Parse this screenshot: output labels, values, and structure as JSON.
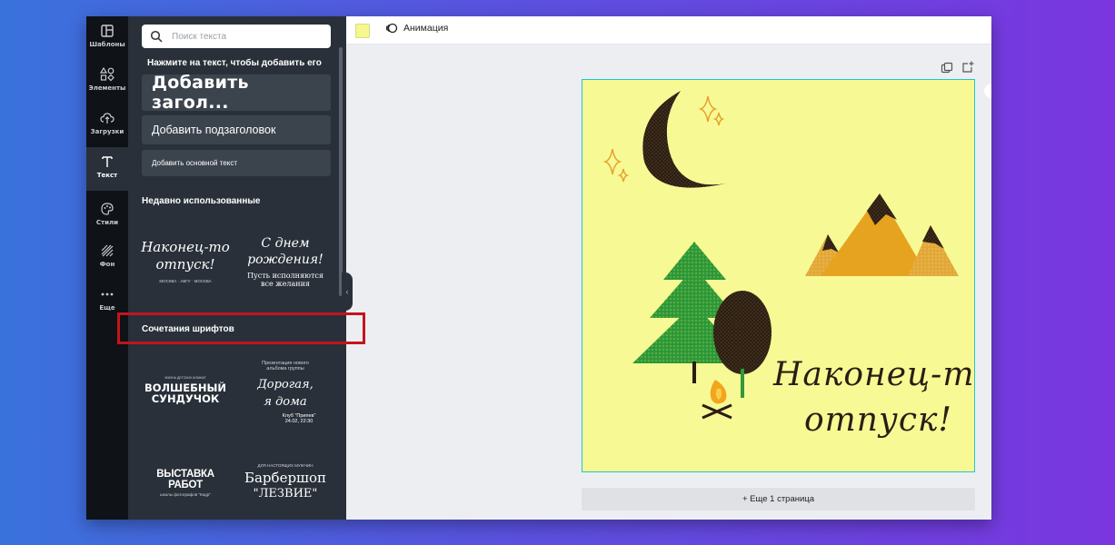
{
  "rail": {
    "items": [
      {
        "label": "Шаблоны",
        "icon": "template-icon"
      },
      {
        "label": "Элементы",
        "icon": "shapes-icon"
      },
      {
        "label": "Загрузки",
        "icon": "upload-cloud-icon"
      },
      {
        "label": "Текст",
        "icon": "text-icon",
        "active": true
      },
      {
        "label": "Стили",
        "icon": "palette-icon"
      },
      {
        "label": "Фон",
        "icon": "background-pattern-icon"
      },
      {
        "label": "Еще",
        "icon": "more-dots-icon"
      }
    ]
  },
  "panel": {
    "search_placeholder": "Поиск текста",
    "hint": "Нажмите на текст, чтобы добавить его",
    "add_heading": "Добавить загол...",
    "add_subheading": "Добавить подзаголовок",
    "add_body": "Добавить основной текст",
    "recent_title": "Недавно использованные",
    "recent": {
      "tile1": {
        "line1": "Наконец-то",
        "line2": "отпуск!",
        "line3": "МОСКВА · АВГУ · МОСКВА"
      },
      "tile2": {
        "line1": "С днем",
        "line2": "рождения!",
        "line3": "Пусть исполняются",
        "line4": "все желания"
      }
    },
    "combos_title": "Сочетания шрифтов",
    "combos": {
      "tile1": {
        "small": "ЖИЗНЬ ДЕТСКИХ КОМНАТ",
        "line1": "ВОЛШЕБНЫЙ",
        "line2": "СУНДУЧОК"
      },
      "tile2": {
        "small1": "Презентация нового",
        "small2": "альбома группы",
        "line1": "Дорогая,",
        "line2": "я дома",
        "club": "Клуб \"Припев\"",
        "date": "24.02, 22:30"
      },
      "tile3": {
        "line1": "ВЫСТАВКА РАБОТ",
        "small": "школы фотографов \"Кадр\""
      },
      "tile4": {
        "small": "ДЛЯ НАСТОЯЩИХ МУЖЧИН",
        "line1": "Барбершоп",
        "line2": "\"ЛЕЗВИЕ\""
      }
    }
  },
  "topbar": {
    "swatch_color": "#f5f88c",
    "animation_label": "Анимация"
  },
  "design": {
    "background": "#f7fa94",
    "line1": "Наконец-то",
    "line2": "отпуск!"
  },
  "add_page_label": "+ Еще 1 страница"
}
